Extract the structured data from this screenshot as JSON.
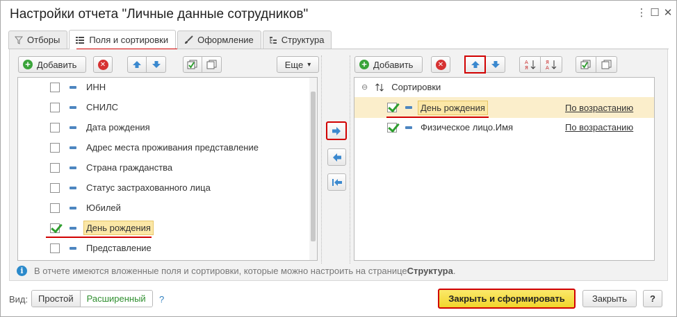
{
  "window": {
    "title": "Настройки отчета \"Личные данные сотрудников\"",
    "more_icon": "more-vertical-icon",
    "maximize_icon": "maximize-icon",
    "close_icon": "close-icon"
  },
  "tabs": [
    {
      "label": "Отборы",
      "icon": "filter-icon"
    },
    {
      "label": "Поля и сортировки",
      "icon": "fields-icon",
      "active": true
    },
    {
      "label": "Оформление",
      "icon": "brush-icon"
    },
    {
      "label": "Структура",
      "icon": "structure-icon"
    }
  ],
  "left_toolbar": {
    "add_label": "Добавить",
    "more_label": "Еще",
    "more_chevron": "▾"
  },
  "left_fields": [
    {
      "label": "ИНН",
      "checked": false
    },
    {
      "label": "СНИЛС",
      "checked": false
    },
    {
      "label": "Дата рождения",
      "checked": false
    },
    {
      "label": "Адрес места проживания представление",
      "checked": false
    },
    {
      "label": "Страна гражданства",
      "checked": false
    },
    {
      "label": "Статус застрахованного лица",
      "checked": false
    },
    {
      "label": "Юбилей",
      "checked": false
    },
    {
      "label": "День рождения",
      "checked": true,
      "highlighted": true
    },
    {
      "label": "Представление",
      "checked": false
    }
  ],
  "right_toolbar": {
    "add_label": "Добавить"
  },
  "sorting": {
    "group_label": "Сортировки",
    "items": [
      {
        "label": "День рождения",
        "order": "По возрастанию",
        "checked": true,
        "selected": true
      },
      {
        "label": "Физическое лицо.Имя",
        "order": "По возрастанию",
        "checked": true,
        "selected": false
      }
    ]
  },
  "info": {
    "text": "В отчете имеются вложенные поля и сортировки, которые можно настроить на странице ",
    "link": "Структура",
    "tail": "."
  },
  "footer": {
    "view_label": "Вид:",
    "simple_label": "Простой",
    "extended_label": "Расширенный",
    "help_link": "?",
    "primary_label": "Закрыть и сформировать",
    "close_label": "Закрыть",
    "help_button": "?"
  },
  "colors": {
    "accent_red": "#d10000",
    "primary_yellow": "#f9e24a",
    "selection": "#fbeecb",
    "arrow_blue": "#3b89cf"
  }
}
